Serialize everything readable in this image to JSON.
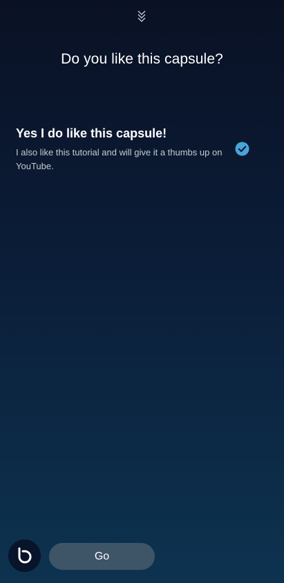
{
  "header": {
    "collapse_icon": "double-chevron-down-icon"
  },
  "prompt": {
    "title": "Do you like this capsule?"
  },
  "options": [
    {
      "title": "Yes I do like this capsule!",
      "description": "I also like this tutorial and will give it a thumbs up on YouTube.",
      "selected": true,
      "selected_icon": "check-circle-icon"
    }
  ],
  "footer": {
    "assistant_icon": "bixby-icon",
    "go_label": "Go"
  },
  "colors": {
    "accent": "#4aa3d8",
    "go_button": "#3e5568",
    "background_top": "#0a1124",
    "background_bottom": "#0d3350"
  }
}
